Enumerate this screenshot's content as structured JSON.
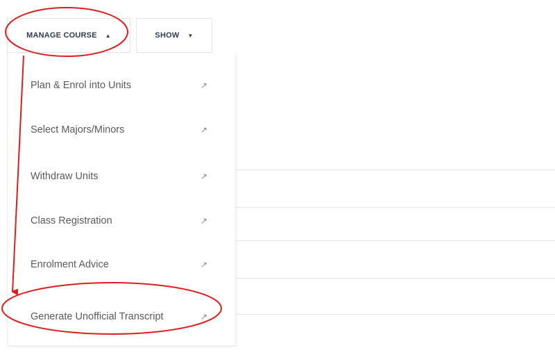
{
  "toolbar": {
    "manage_course": {
      "label": "MANAGE COURSE",
      "caret": "▲"
    },
    "show": {
      "label": "SHOW",
      "caret": "▼"
    }
  },
  "menu": {
    "items": [
      {
        "label": "Plan & Enrol into Units",
        "icon": "external-link-icon",
        "arrow": "↗"
      },
      {
        "label": "Select Majors/Minors",
        "icon": "external-link-icon",
        "arrow": "↗"
      },
      {
        "label": "Withdraw Units",
        "icon": "external-link-icon",
        "arrow": "↗"
      },
      {
        "label": "Class Registration",
        "icon": "external-link-icon",
        "arrow": "↗"
      },
      {
        "label": "Enrolment Advice",
        "icon": "external-link-icon",
        "arrow": "↗"
      },
      {
        "label": "Generate Unofficial Transcript",
        "icon": "external-link-icon",
        "arrow": "↗"
      }
    ]
  },
  "annotation": {
    "color": "#e01b1b"
  },
  "colors": {
    "button_text": "#2f3a55",
    "menu_text": "#5a5a5a",
    "border": "#e4e4e4"
  }
}
